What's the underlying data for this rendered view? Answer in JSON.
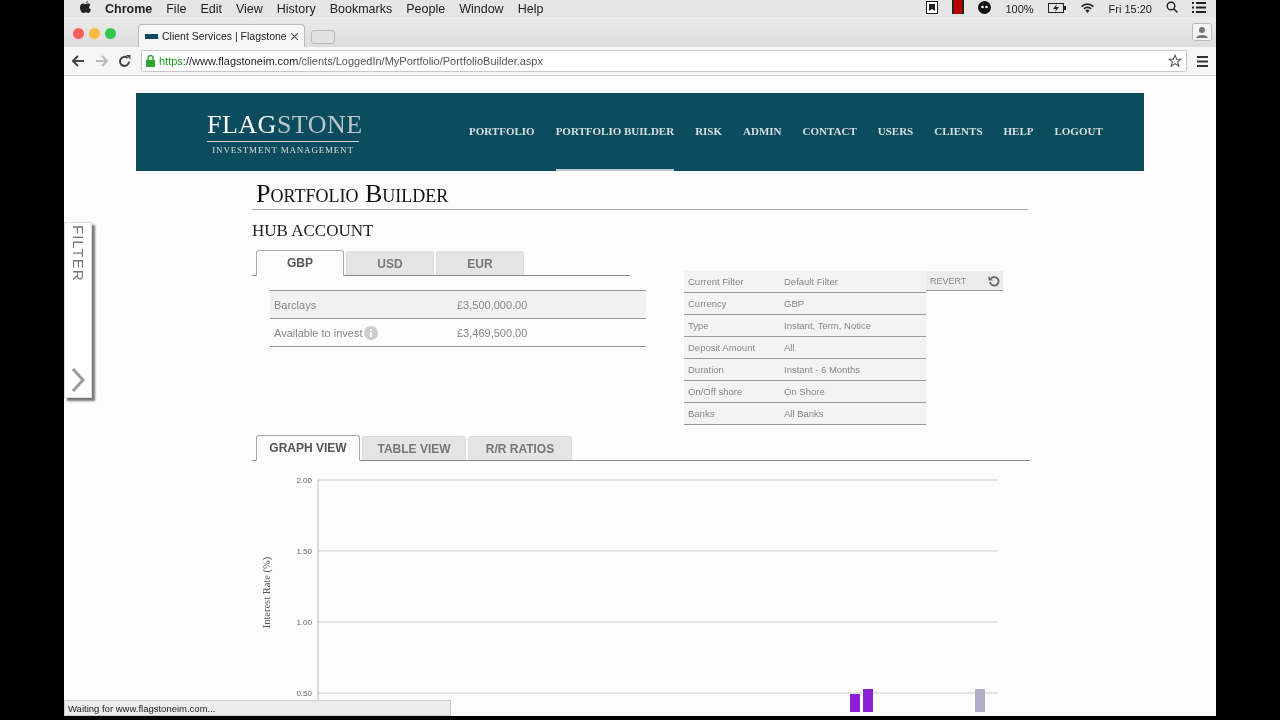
{
  "menu_bar": {
    "app": "Chrome",
    "items": [
      "File",
      "Edit",
      "View",
      "History",
      "Bookmarks",
      "People",
      "Window",
      "Help"
    ],
    "battery": "100%",
    "clock": "Fri 15:20"
  },
  "browser": {
    "tab_title": "Client Services | Flagstone",
    "url_scheme": "https",
    "url_host": "://www.flagstoneim.com",
    "url_path": "/clients/LoggedIn/MyPortfolio/PortfolioBuilder.aspx",
    "status": "Waiting for www.flagstoneim.com..."
  },
  "logo": {
    "name_parts": [
      "FLAG",
      "STONE"
    ],
    "tagline": "INVESTMENT MANAGEMENT"
  },
  "nav": [
    {
      "label": "PORTFOLIO",
      "selected": false
    },
    {
      "label": "PORTFOLIO BUILDER",
      "selected": true
    },
    {
      "label": "RISK",
      "selected": false
    },
    {
      "label": "ADMIN",
      "selected": false
    },
    {
      "label": "CONTACT",
      "selected": false
    },
    {
      "label": "USERS",
      "selected": false
    },
    {
      "label": "CLIENTS",
      "selected": false
    },
    {
      "label": "HELP",
      "selected": false
    },
    {
      "label": "LOGOUT",
      "selected": false
    }
  ],
  "filter_tab": "FILTER",
  "page_title": "Portfolio Builder",
  "section_title": "HUB ACCOUNT",
  "currency_tabs": [
    {
      "label": "GBP",
      "selected": true
    },
    {
      "label": "USD",
      "selected": false
    },
    {
      "label": "EUR",
      "selected": false
    }
  ],
  "balances": [
    {
      "label": "Barclays",
      "amount": "£3,500,000.00",
      "info": false
    },
    {
      "label": "Available to invest",
      "amount": "£3,469,500.00",
      "info": true
    }
  ],
  "filter_summary": {
    "revert": "REVERT",
    "rows": [
      {
        "label": "Current Filter",
        "value": "Default Filter"
      },
      {
        "label": "Currency",
        "value": "GBP"
      },
      {
        "label": "Type",
        "value": "Instant, Term, Notice"
      },
      {
        "label": "Deposit Amount",
        "value": "All"
      },
      {
        "label": "Duration",
        "value": "Instant - 6 Months"
      },
      {
        "label": "On/Off shore",
        "value": "On Shore"
      },
      {
        "label": "Banks",
        "value": "All Banks"
      }
    ]
  },
  "view_tabs": [
    {
      "label": "GRAPH VIEW",
      "selected": true
    },
    {
      "label": "TABLE VIEW",
      "selected": false
    },
    {
      "label": "R/R RATIOS",
      "selected": false
    }
  ],
  "chart": {
    "ylabel": "Interest Rate (%)",
    "yticks": [
      "2.00",
      "1.50",
      "1.00",
      "0.50"
    ]
  }
}
